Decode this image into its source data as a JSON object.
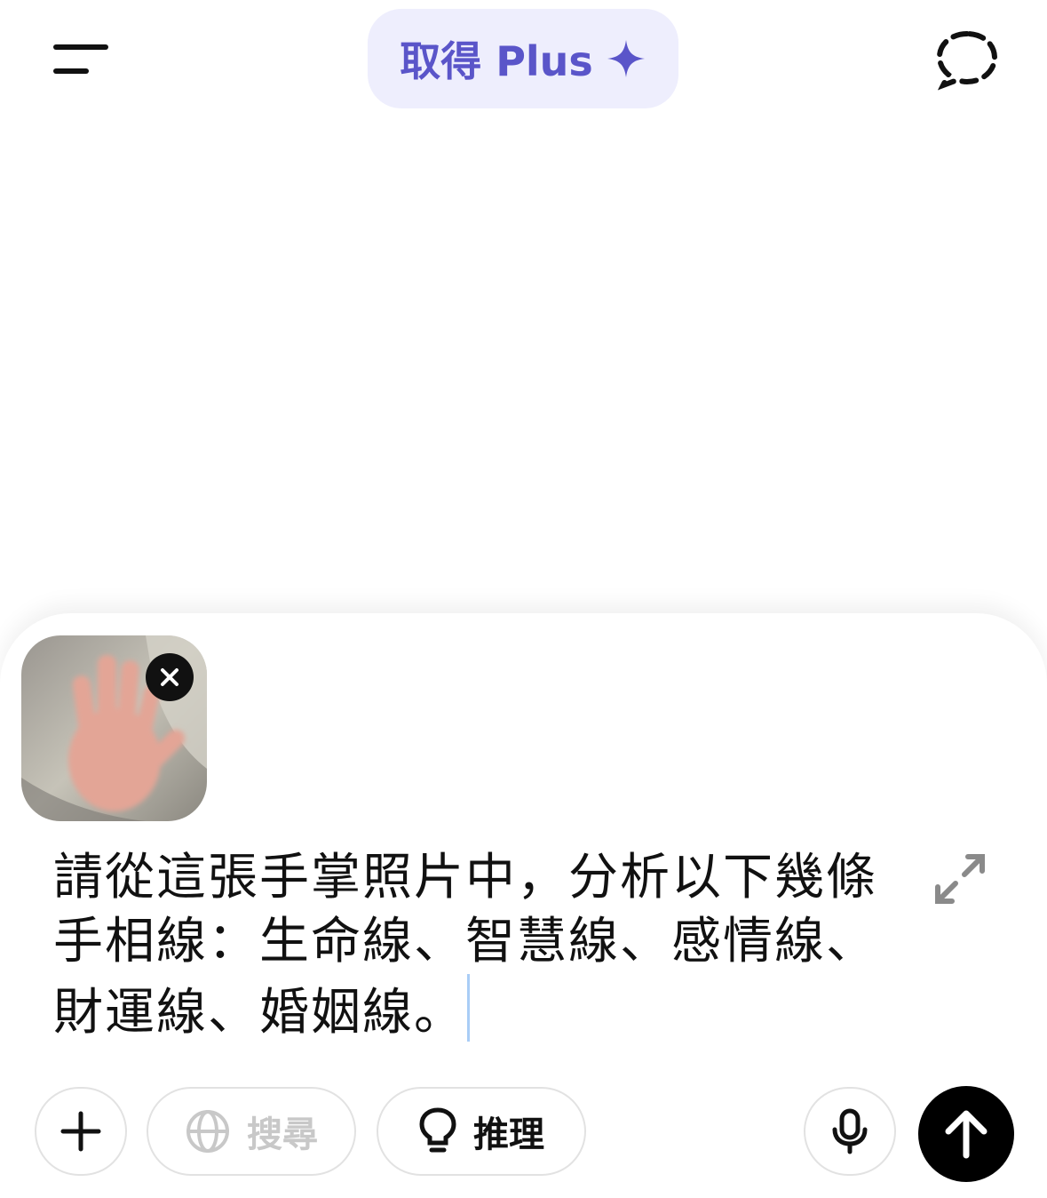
{
  "header": {
    "menu_icon": "menu-icon",
    "upgrade_label": "取得 Plus",
    "upgrade_icon": "sparkle-icon",
    "temp_chat_icon": "dashed-chat-bubble-icon",
    "accent_color": "#5a55c9",
    "pill_bg": "#eeeefd"
  },
  "composer": {
    "attachment_icon": "image-thumbnail",
    "remove_icon": "close-icon",
    "prompt_lines": [
      "請從這張手掌照片中，分析以下幾條",
      "手相線：生命線、智慧線、感情線、",
      "財運線、婚姻線。"
    ],
    "expand_icon": "expand-icon",
    "add_icon": "plus-icon",
    "search_label": "搜尋",
    "search_icon": "globe-icon",
    "reason_label": "推理",
    "reason_icon": "lightbulb-icon",
    "mic_icon": "microphone-icon",
    "send_icon": "arrow-up-icon"
  }
}
